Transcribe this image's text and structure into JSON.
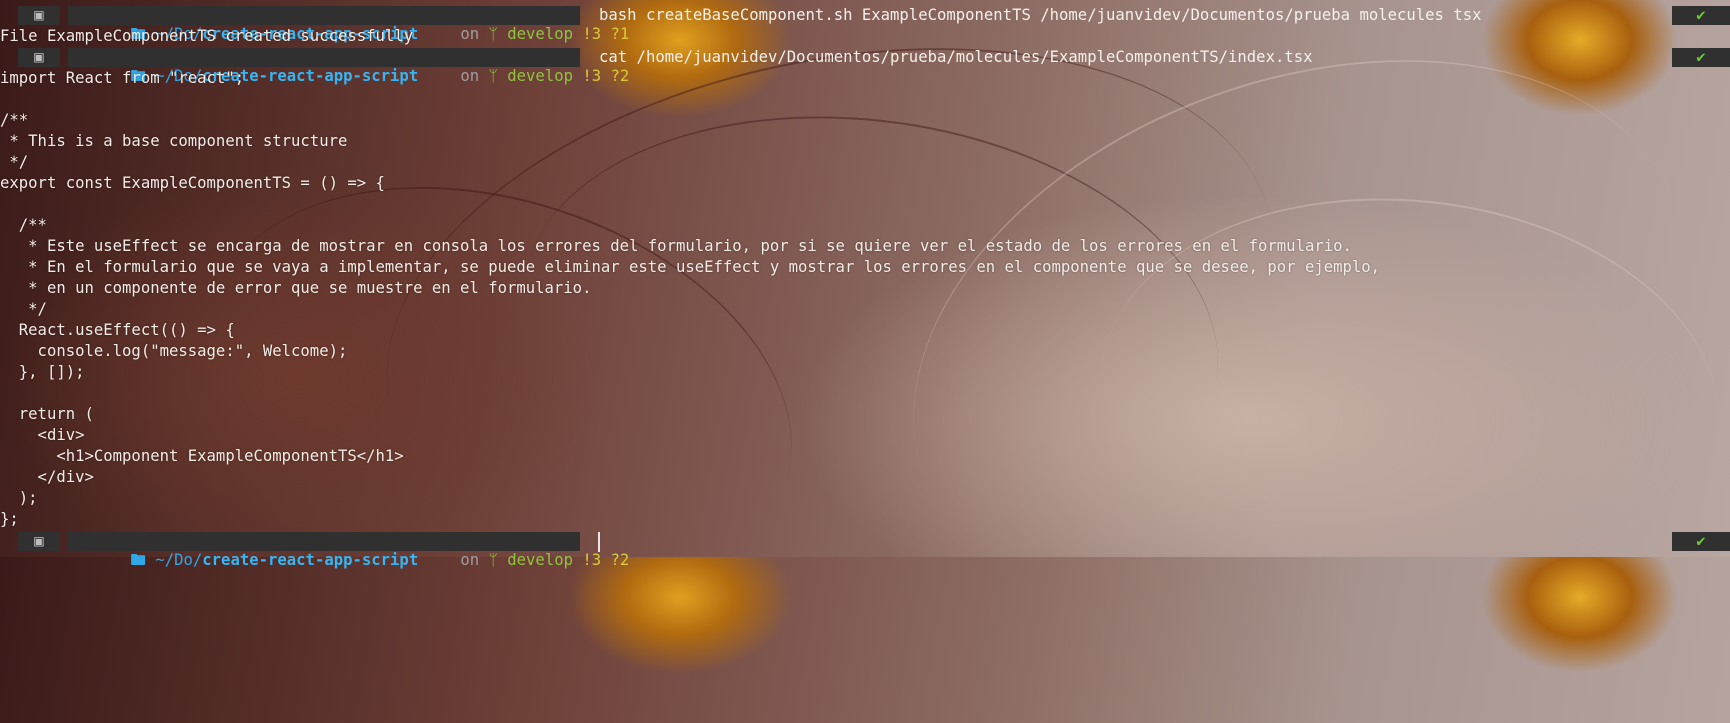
{
  "prompts": [
    {
      "os_icon": "terminal-icon",
      "home": "~/Do/",
      "repo": "create-react-app-script",
      "on": "on",
      "branch": "develop",
      "status": "!3 ?1",
      "command": "bash createBaseComponent.sh ExampleComponentTS /home/juanvidev/Documentos/prueba molecules tsx",
      "ok": "✔"
    },
    {
      "os_icon": "terminal-icon",
      "home": "~/Do/",
      "repo": "create-react-app-script",
      "on": "on",
      "branch": "develop",
      "status": "!3 ?2",
      "command": "cat /home/juanvidev/Documentos/prueba/molecules/ExampleComponentTS/index.tsx",
      "ok": "✔"
    },
    {
      "os_icon": "terminal-icon",
      "home": "~/Do/",
      "repo": "create-react-app-script",
      "on": "on",
      "branch": "develop",
      "status": "!3 ?2",
      "command": "",
      "ok": "✔"
    }
  ],
  "output_first": "File ExampleComponentTS created successfully",
  "file_lines": [
    "import React from \"react\";",
    "",
    "/**",
    " * This is a base component structure",
    " */",
    "export const ExampleComponentTS = () => {",
    "",
    "  /**",
    "   * Este useEffect se encarga de mostrar en consola los errores del formulario, por si se quiere ver el estado de los errores en el formulario.",
    "   * En el formulario que se vaya a implementar, se puede eliminar este useEffect y mostrar los errores en el componente que se desee, por ejemplo,",
    "   * en un componente de error que se muestre en el formulario.",
    "   */",
    "  React.useEffect(() => {",
    "    console.log(\"message:\", Welcome);",
    "  }, []);",
    "",
    "  return (",
    "    <div>",
    "      <h1>Component ExampleComponentTS</h1>",
    "    </div>",
    "  );",
    "};"
  ],
  "colors": {
    "segment_bg": "#303030",
    "dir": "#35b6f4",
    "git": "#8ec63f",
    "status": "#d8c93a",
    "ok": "#6ec53c"
  }
}
